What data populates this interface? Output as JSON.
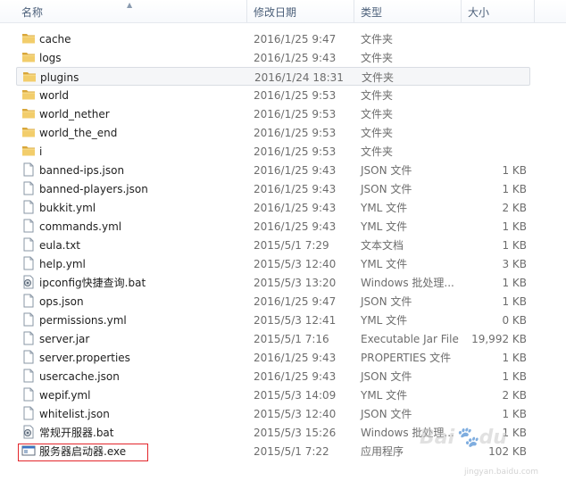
{
  "columns": {
    "name": "名称",
    "date": "修改日期",
    "type": "类型",
    "size": "大小"
  },
  "files": [
    {
      "name": "cache",
      "date": "2016/1/25 9:47",
      "type": "文件夹",
      "size": "",
      "icon": "folder-icon"
    },
    {
      "name": "logs",
      "date": "2016/1/25 9:43",
      "type": "文件夹",
      "size": "",
      "icon": "folder-icon"
    },
    {
      "name": "plugins",
      "date": "2016/1/24 18:31",
      "type": "文件夹",
      "size": "",
      "icon": "folder-icon"
    },
    {
      "name": "world",
      "date": "2016/1/25 9:53",
      "type": "文件夹",
      "size": "",
      "icon": "folder-icon"
    },
    {
      "name": "world_nether",
      "date": "2016/1/25 9:53",
      "type": "文件夹",
      "size": "",
      "icon": "folder-icon"
    },
    {
      "name": "world_the_end",
      "date": "2016/1/25 9:53",
      "type": "文件夹",
      "size": "",
      "icon": "folder-icon"
    },
    {
      "name": "i",
      "date": "2016/1/25 9:53",
      "type": "文件夹",
      "size": "",
      "icon": "folder-icon"
    },
    {
      "name": "banned-ips.json",
      "date": "2016/1/25 9:43",
      "type": "JSON 文件",
      "size": "1 KB",
      "icon": "file-icon"
    },
    {
      "name": "banned-players.json",
      "date": "2016/1/25 9:43",
      "type": "JSON 文件",
      "size": "1 KB",
      "icon": "file-icon"
    },
    {
      "name": "bukkit.yml",
      "date": "2016/1/25 9:43",
      "type": "YML 文件",
      "size": "2 KB",
      "icon": "file-icon"
    },
    {
      "name": "commands.yml",
      "date": "2016/1/25 9:43",
      "type": "YML 文件",
      "size": "1 KB",
      "icon": "file-icon"
    },
    {
      "name": "eula.txt",
      "date": "2015/5/1 7:29",
      "type": "文本文档",
      "size": "1 KB",
      "icon": "file-icon"
    },
    {
      "name": "help.yml",
      "date": "2015/5/3 12:40",
      "type": "YML 文件",
      "size": "3 KB",
      "icon": "file-icon"
    },
    {
      "name": "ipconfig快捷查询.bat",
      "date": "2015/5/3 13:20",
      "type": "Windows 批处理...",
      "size": "1 KB",
      "icon": "batch-icon"
    },
    {
      "name": "ops.json",
      "date": "2016/1/25 9:47",
      "type": "JSON 文件",
      "size": "1 KB",
      "icon": "file-icon"
    },
    {
      "name": "permissions.yml",
      "date": "2015/5/3 12:41",
      "type": "YML 文件",
      "size": "0 KB",
      "icon": "file-icon"
    },
    {
      "name": "server.jar",
      "date": "2015/5/1 7:16",
      "type": "Executable Jar File",
      "size": "19,992 KB",
      "icon": "file-icon"
    },
    {
      "name": "server.properties",
      "date": "2016/1/25 9:43",
      "type": "PROPERTIES 文件",
      "size": "1 KB",
      "icon": "file-icon"
    },
    {
      "name": "usercache.json",
      "date": "2016/1/25 9:43",
      "type": "JSON 文件",
      "size": "1 KB",
      "icon": "file-icon"
    },
    {
      "name": "wepif.yml",
      "date": "2015/5/3 14:09",
      "type": "YML 文件",
      "size": "2 KB",
      "icon": "file-icon"
    },
    {
      "name": "whitelist.json",
      "date": "2015/5/3 12:40",
      "type": "JSON 文件",
      "size": "1 KB",
      "icon": "file-icon"
    },
    {
      "name": "常规开服器.bat",
      "date": "2015/5/3 15:26",
      "type": "Windows 批处理...",
      "size": "1 KB",
      "icon": "batch-icon"
    },
    {
      "name": "服务器启动器.exe",
      "date": "2015/5/1 7:22",
      "type": "应用程序",
      "size": "102 KB",
      "icon": "exe-icon"
    }
  ],
  "hover_row_index": 2,
  "highlighted_row_index": 22,
  "watermark": {
    "text": "Baidu经验",
    "sub": "jingyan.baidu.com"
  },
  "colors": {
    "header_text": "#4c607a",
    "folder": "#e8b84a",
    "highlight_border": "#e3262b"
  }
}
